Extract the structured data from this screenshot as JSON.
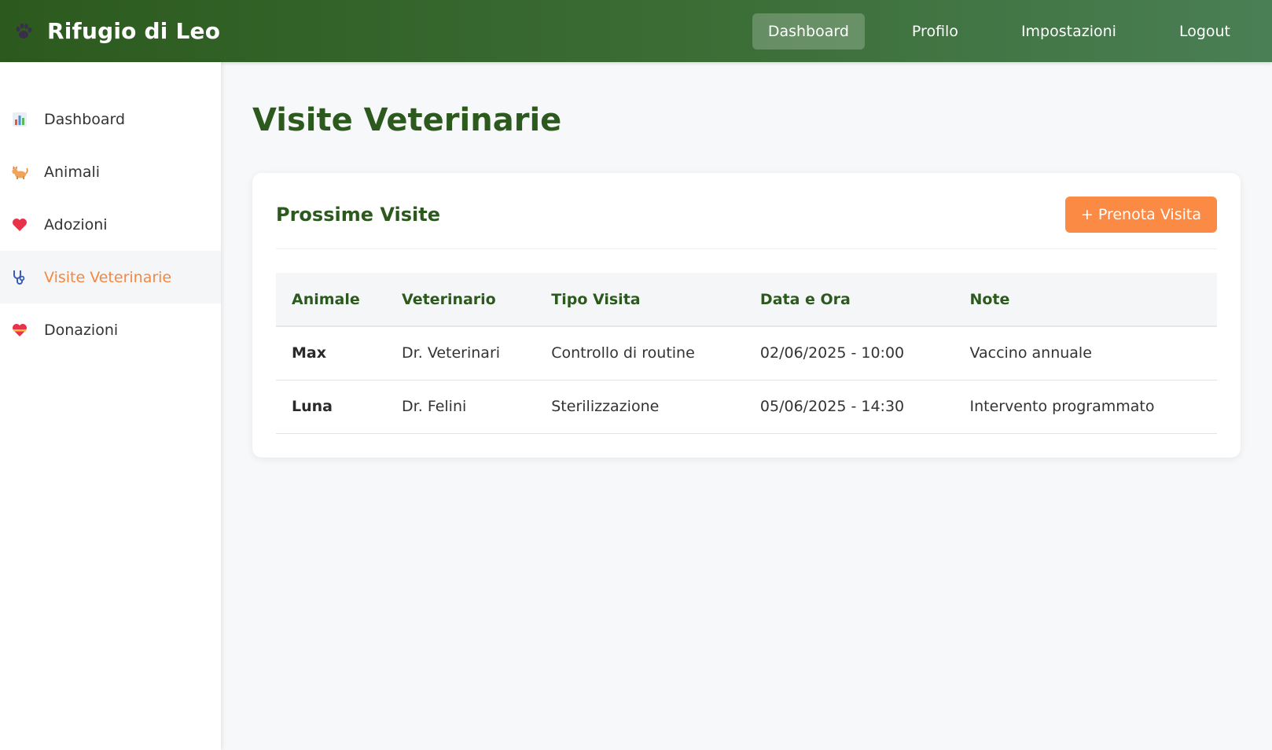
{
  "header": {
    "brand_title": "Rifugio di Leo",
    "brand_icon": "paw-icon",
    "nav": [
      {
        "label": "Dashboard",
        "active": true
      },
      {
        "label": "Profilo",
        "active": false
      },
      {
        "label": "Impostazioni",
        "active": false
      },
      {
        "label": "Logout",
        "active": false
      }
    ]
  },
  "sidebar": {
    "items": [
      {
        "label": "Dashboard",
        "icon": "bar-chart-icon",
        "active": false
      },
      {
        "label": "Animali",
        "icon": "cat-icon",
        "active": false
      },
      {
        "label": "Adozioni",
        "icon": "heart-icon",
        "active": false
      },
      {
        "label": "Visite Veterinarie",
        "icon": "stethoscope-icon",
        "active": true
      },
      {
        "label": "Donazioni",
        "icon": "heart-gift-icon",
        "active": false
      }
    ]
  },
  "main": {
    "page_title": "Visite Veterinarie",
    "card": {
      "title": "Prossime Visite",
      "book_button": "+ Prenota Visita",
      "table": {
        "columns": [
          "Animale",
          "Veterinario",
          "Tipo Visita",
          "Data e Ora",
          "Note"
        ],
        "rows": [
          [
            "Max",
            "Dr. Veterinari",
            "Controllo di routine",
            "02/06/2025 - 10:00",
            "Vaccino annuale"
          ],
          [
            "Luna",
            "Dr. Felini",
            "Sterilizzazione",
            "05/06/2025 - 14:30",
            "Intervento programmato"
          ]
        ]
      }
    }
  },
  "colors": {
    "primary_green": "#2c5a1e",
    "accent_orange": "#fb8a44",
    "active_sidebar_text": "#f5873f"
  }
}
